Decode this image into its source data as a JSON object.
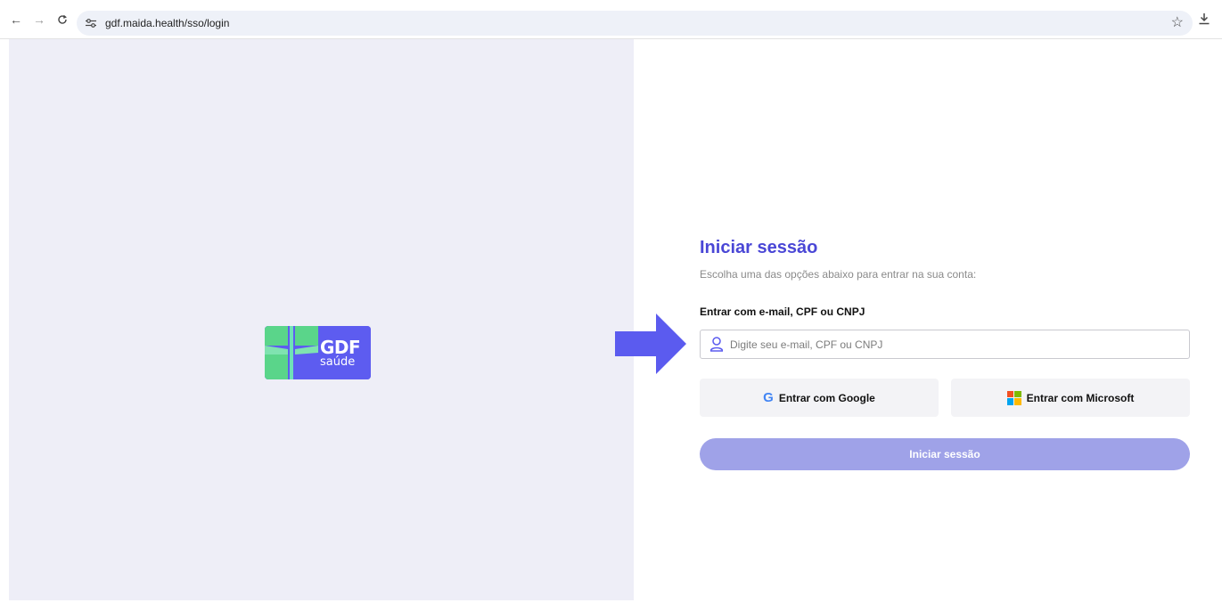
{
  "browser": {
    "url": "gdf.maida.health/sso/login",
    "back_icon": "←",
    "forward_icon": "→",
    "reload_icon": "C",
    "site_info_icon": "≡",
    "star_icon": "☆",
    "download_icon": "⤓"
  },
  "brand": {
    "logo_title": "GDF",
    "logo_subtitle": "saúde",
    "panel_color": "#eeeef7",
    "logo_color": "#5d5cf0"
  },
  "annotation": {
    "arrow_color": "#5b5bef"
  },
  "login": {
    "title": "Iniciar sessão",
    "subtitle": "Escolha uma das opções abaixo para entrar na sua conta:",
    "field_label": "Entrar com e-mail, CPF ou CNPJ",
    "field_placeholder": "Digite seu e-mail, CPF ou CNPJ",
    "field_value": "",
    "google_icon": "G",
    "google_label": "Entrar com Google",
    "microsoft_label": "Entrar com Microsoft",
    "submit_label": "Iniciar sessão",
    "accent_color": "#4a47d6",
    "submit_color_disabled": "#9fa2e8"
  }
}
